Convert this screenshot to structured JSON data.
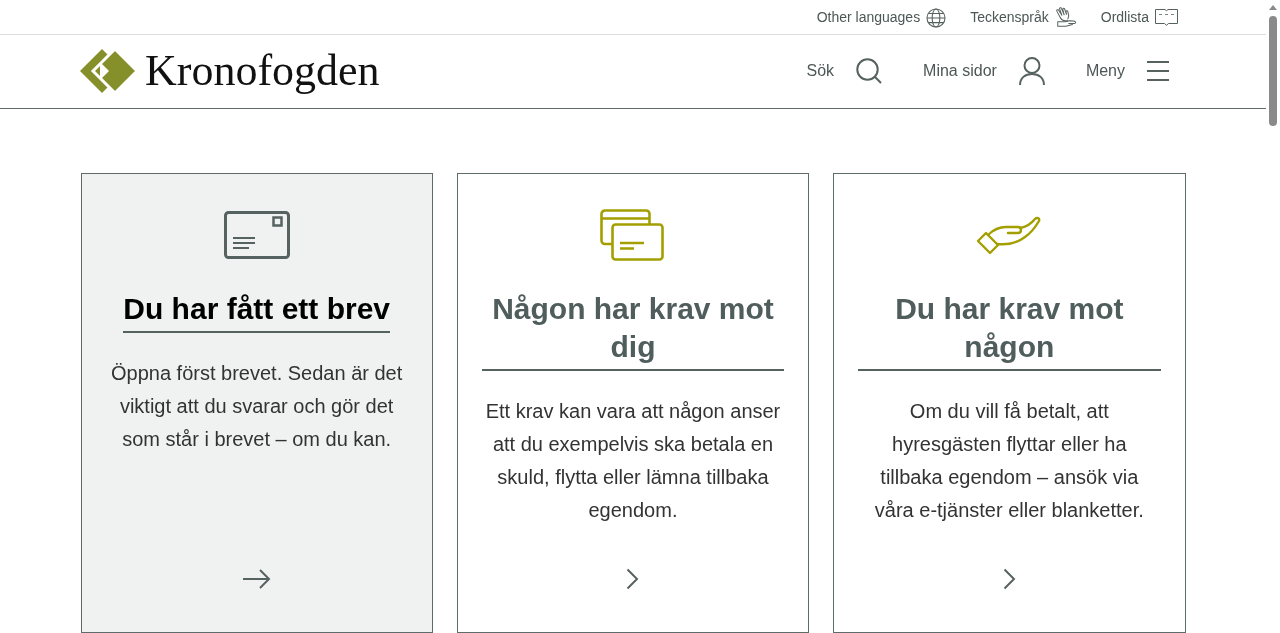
{
  "utility_links": [
    {
      "kind": "languages",
      "label": "Other languages"
    },
    {
      "kind": "sign_language",
      "label": "Teckenspråk"
    },
    {
      "kind": "glossary",
      "label": "Ordlista"
    }
  ],
  "header": {
    "logo": "Kronofogden",
    "nav": [
      {
        "kind": "search",
        "label": "Sök"
      },
      {
        "kind": "account",
        "label": "Mina sidor"
      },
      {
        "kind": "menu",
        "label": "Meny"
      }
    ]
  },
  "cards": [
    {
      "kind": "letter",
      "title": "Du har fått ett brev",
      "text": "Öppna först brevet. Sedan är det viktigt att du svarar och gör det som står i brevet – om du kan.",
      "highlighted": true
    },
    {
      "kind": "claim_against_you",
      "title": "Någon har krav mot dig",
      "text": "Ett krav kan vara att någon anser att du exempelvis ska betala en skuld, flytta eller lämna tillbaka egendom.",
      "highlighted": false
    },
    {
      "kind": "claim_by_you",
      "title": "Du har krav mot någon",
      "text": "Om du vill få betalt, att hyresgästen flyttar eller ha tillbaka egendom – ansök via våra e-tjänster eller blanketter.",
      "highlighted": false
    }
  ]
}
